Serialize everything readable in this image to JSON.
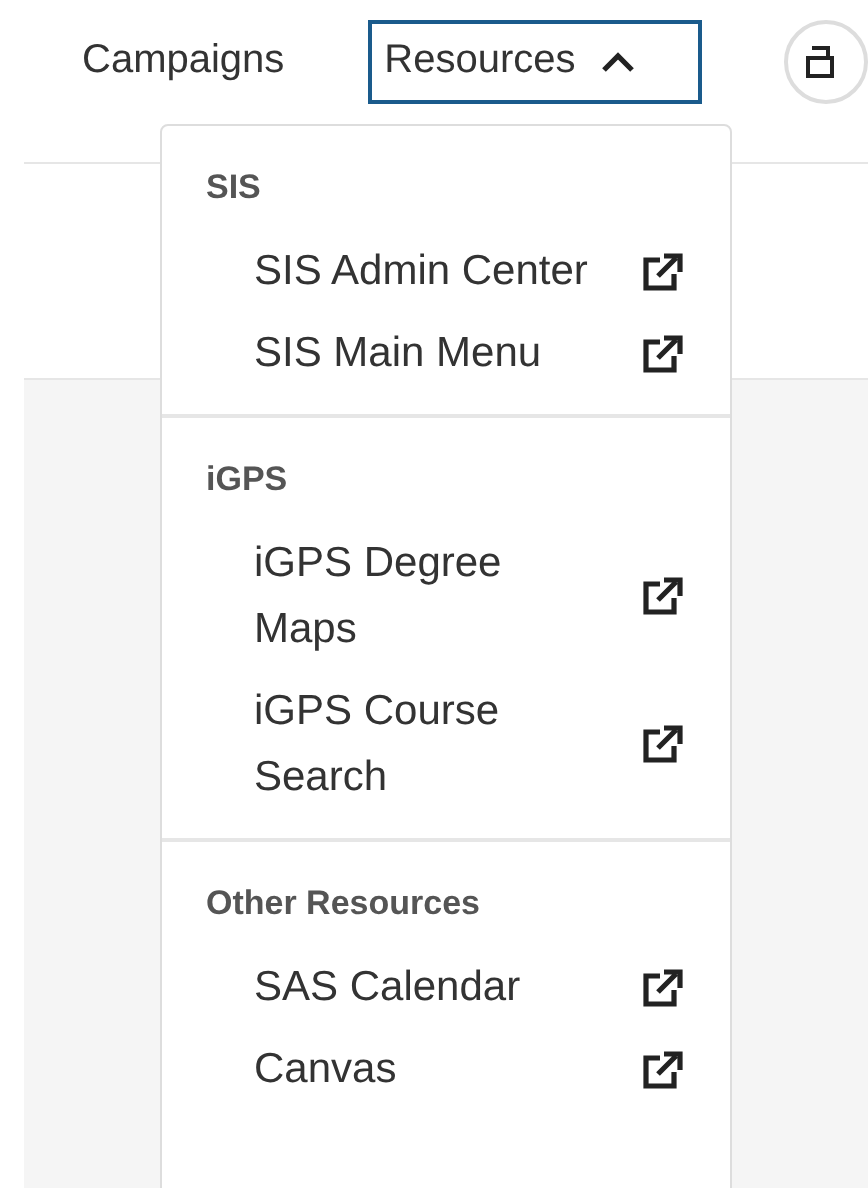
{
  "nav": [
    {
      "label": "Campaigns",
      "kind": "link"
    },
    {
      "label": "Resources",
      "kind": "dropdown",
      "expanded": true
    }
  ],
  "dropdown": {
    "sections": [
      {
        "heading": "SIS",
        "items": [
          {
            "label": "SIS Admin Center",
            "external": true
          },
          {
            "label": "SIS Main Menu",
            "external": true
          }
        ]
      },
      {
        "heading": "iGPS",
        "items": [
          {
            "label": "iGPS Degree Maps",
            "external": true
          },
          {
            "label": "iGPS Course Search",
            "external": true
          }
        ]
      },
      {
        "heading": "Other Resources",
        "items": [
          {
            "label": "SAS Calendar",
            "external": true
          },
          {
            "label": "Canvas",
            "external": true
          }
        ]
      }
    ]
  }
}
